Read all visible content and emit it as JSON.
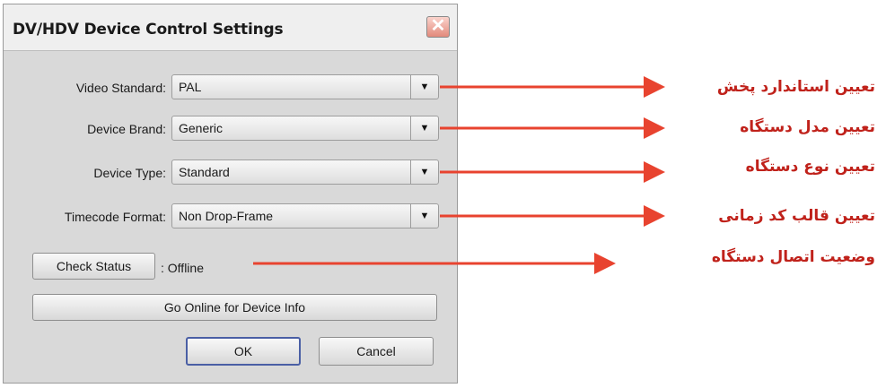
{
  "dialog": {
    "title": "DV/HDV Device Control Settings",
    "close_icon": "close-icon",
    "fields": [
      {
        "label": "Video Standard:",
        "value": "PAL"
      },
      {
        "label": "Device Brand:",
        "value": "Generic"
      },
      {
        "label": "Device Type:",
        "value": "Standard"
      },
      {
        "label": "Timecode Format:",
        "value": "Non Drop-Frame"
      }
    ],
    "check_status_label": "Check Status",
    "status_text": ": Offline",
    "go_online_label": "Go Online for Device Info",
    "ok_label": "OK",
    "cancel_label": "Cancel",
    "dropdown_icon": "triangle-down-icon"
  },
  "annotations": [
    "تعیین استاندارد پخش",
    "تعیین مدل دستگاه",
    "تعیین نوع دستگاه",
    "تعیین قالب کد زمانی",
    "وضعیت اتصال دستگاه"
  ],
  "colors": {
    "annotation": "#c0221b",
    "arrow": "#e8432f",
    "dialog_bg": "#d9d9d9"
  }
}
